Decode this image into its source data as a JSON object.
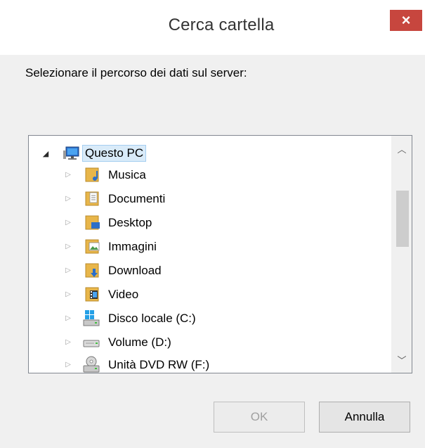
{
  "dialog": {
    "title": "Cerca cartella",
    "close_label": "×",
    "instruction": "Selezionare il percorso dei dati sul server:"
  },
  "tree": {
    "root": {
      "label": "Questo PC",
      "icon": "computer-icon",
      "expanded": true,
      "selected": true
    },
    "items": [
      {
        "label": "Musica",
        "icon": "music-folder-icon"
      },
      {
        "label": "Documenti",
        "icon": "documents-folder-icon"
      },
      {
        "label": "Desktop",
        "icon": "desktop-folder-icon"
      },
      {
        "label": "Immagini",
        "icon": "pictures-folder-icon"
      },
      {
        "label": "Download",
        "icon": "downloads-folder-icon"
      },
      {
        "label": "Video",
        "icon": "videos-folder-icon"
      },
      {
        "label": "Disco locale (C:)",
        "icon": "local-disk-icon"
      },
      {
        "label": "Volume (D:)",
        "icon": "drive-icon"
      },
      {
        "label": "Unità DVD RW (F:)",
        "icon": "dvd-drive-icon"
      }
    ]
  },
  "buttons": {
    "ok_label": "OK",
    "cancel_label": "Annulla"
  },
  "colors": {
    "close_button": "#c7463e",
    "selection_background": "#d9ebf9",
    "selection_border": "#a4cef0",
    "folder": "#e8b64a"
  }
}
